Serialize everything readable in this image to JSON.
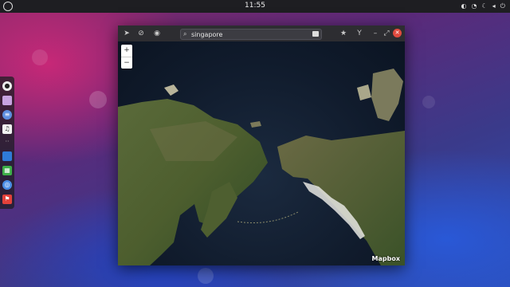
{
  "topbar": {
    "clock": "11:55",
    "tray_icons": [
      "notifications-icon",
      "wifi-icon",
      "moon-icon",
      "volume-icon",
      "power-icon"
    ]
  },
  "dock": {
    "apps": [
      "soccer-app-icon",
      "files-icon",
      "settings-icon",
      "music-icon",
      "spacer-icon",
      "documents-icon",
      "spreadsheet-icon",
      "web-browser-icon",
      "maps-icon"
    ]
  },
  "maps_window": {
    "search": {
      "value": "singapore",
      "placeholder": ""
    },
    "zoom_in_label": "+",
    "zoom_out_label": "−",
    "attribution": "Mapbox"
  },
  "colors": {
    "window_header": "#2d2d31",
    "close_button": "#e04a3f",
    "topbar": "#1e1e22"
  }
}
